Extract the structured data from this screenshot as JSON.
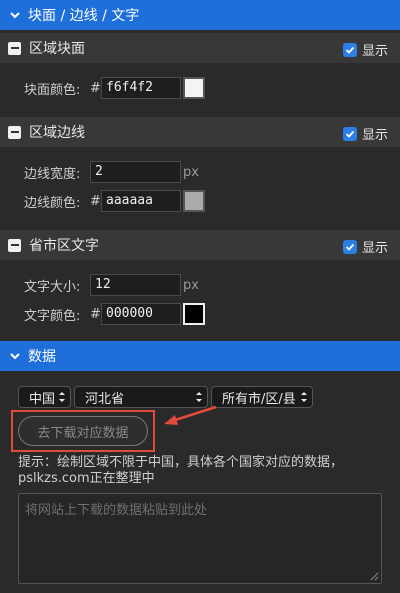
{
  "header_top": {
    "title": "块面 / 边线 / 文字"
  },
  "show_label": "显示",
  "block": {
    "title": "区域块面",
    "color_label": "块面颜色:",
    "hash": "#",
    "color_value": "f6f4f2",
    "swatch": "#f6f4f2"
  },
  "border": {
    "title": "区域边线",
    "width_label": "边线宽度:",
    "width_value": "2",
    "width_unit": "px",
    "color_label": "边线颜色:",
    "hash": "#",
    "color_value": "aaaaaa",
    "swatch": "#aaaaaa"
  },
  "text": {
    "title": "省市区文字",
    "size_label": "文字大小:",
    "size_value": "12",
    "size_unit": "px",
    "color_label": "文字颜色:",
    "hash": "#",
    "color_value": "000000",
    "swatch": "#000000"
  },
  "data_section": {
    "title": "数据",
    "country": "中国",
    "province": "河北省",
    "city": "所有市/区/县",
    "download_button": "去下载对应数据",
    "tip": "提示：绘制区域不限于中国，具体各个国家对应的数据，pslkzs.com正在整理中",
    "paste_placeholder": "将网站上下载的数据粘贴到此处"
  },
  "colors": {
    "accent": "#1e6fd9",
    "highlight": "#e14b3b",
    "checkbox": "#2d7fe8"
  }
}
